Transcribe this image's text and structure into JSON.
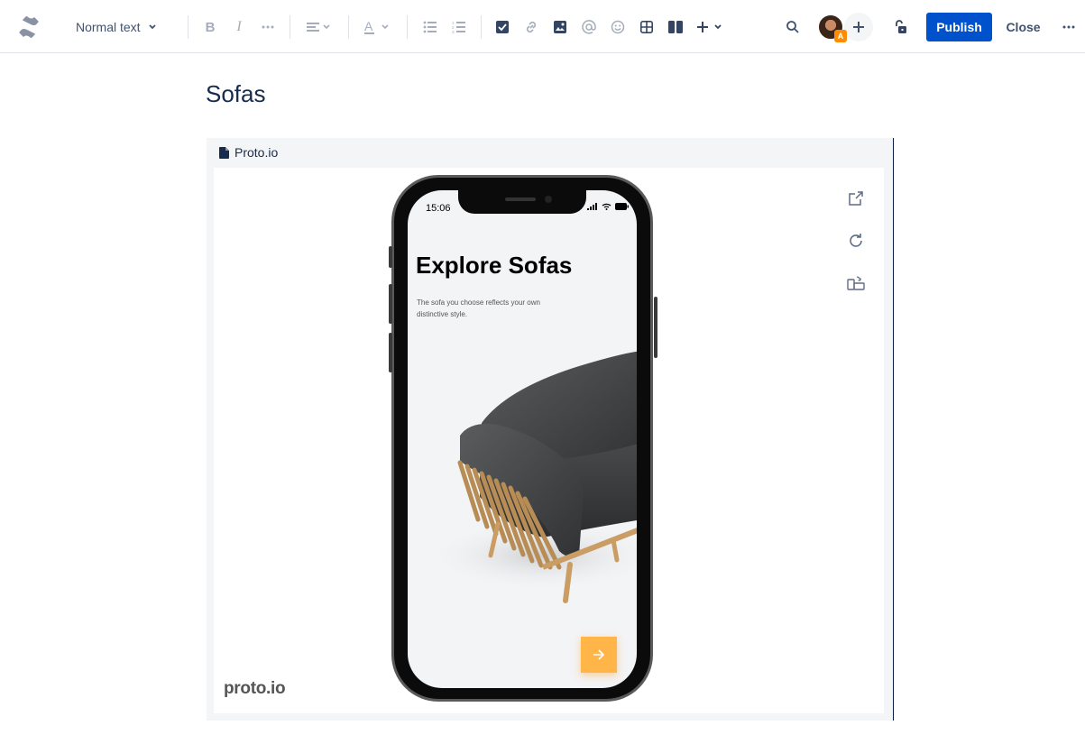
{
  "toolbar": {
    "text_style": "Normal text",
    "publish_label": "Publish",
    "close_label": "Close",
    "avatar_badge": "A",
    "icons": [
      "confluence-logo-icon",
      "bold-icon",
      "italic-icon",
      "more-formatting-icon",
      "align-icon",
      "text-color-icon",
      "bullet-list-icon",
      "numbered-list-icon",
      "task-icon",
      "link-icon",
      "image-icon",
      "mention-icon",
      "emoji-icon",
      "table-icon",
      "layouts-icon",
      "insert-icon",
      "search-icon",
      "add-collaborator-icon",
      "restrictions-icon",
      "more-icon"
    ]
  },
  "page": {
    "title": "Sofas"
  },
  "embed": {
    "source": "Proto.io",
    "logo": "proto.io",
    "side_tools": [
      "open-external-icon",
      "reload-icon",
      "rotate-device-icon"
    ],
    "prototype": {
      "time": "15:06",
      "title": "Explore Sofas",
      "subtitle": "The sofa you choose reflects your own distinctive style."
    }
  },
  "colors": {
    "primary": "#0052cc",
    "accent": "#ffb547",
    "text": "#172b4d",
    "badge": "#ff8b00"
  }
}
